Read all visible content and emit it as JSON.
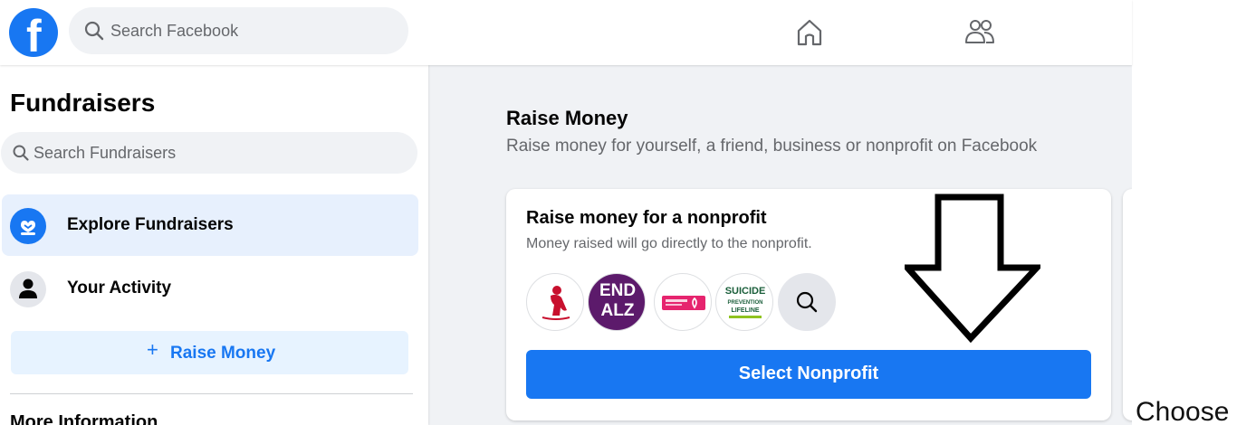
{
  "header": {
    "logo_letter": "f",
    "search_placeholder": "Search Facebook",
    "nav": [
      "home-icon",
      "friends-icon"
    ]
  },
  "sidebar": {
    "title": "Fundraisers",
    "search_placeholder": "Search Fundraisers",
    "items": [
      {
        "label": "Explore Fundraisers",
        "icon": "fundraiser-heart-icon",
        "active": true
      },
      {
        "label": "Your Activity",
        "icon": "person-icon",
        "active": false
      }
    ],
    "raise_button": {
      "plus": "+",
      "label": "Raise Money"
    },
    "more_info": "More Information"
  },
  "main": {
    "title": "Raise Money",
    "subtitle": "Raise money for yourself, a friend, business or nonprofit on Facebook",
    "card": {
      "title": "Raise money for a nonprofit",
      "description": "Money raised will go directly to the nonprofit.",
      "orgs": [
        {
          "name": "st-jude-logo"
        },
        {
          "name": "end-alz-logo",
          "text_line1": "END",
          "text_line2": "ALZ"
        },
        {
          "name": "breast-cancer-logo"
        },
        {
          "name": "suicide-prevention-lifeline-logo",
          "text_line1": "SUICIDE",
          "text_line2": "PREVENTION",
          "text_line3": "LIFELINE"
        }
      ],
      "select_button": "Select Nonprofit"
    }
  },
  "annotation": {
    "caption": "Choose",
    "arrow_icon": "down-arrow-icon"
  },
  "colors": {
    "brand_blue": "#1877f2",
    "light_blue": "#e7f3ff",
    "gray_bg": "#f0f2f5",
    "secondary_text": "#65676b",
    "end_alz_purple": "#5c1a6b"
  }
}
